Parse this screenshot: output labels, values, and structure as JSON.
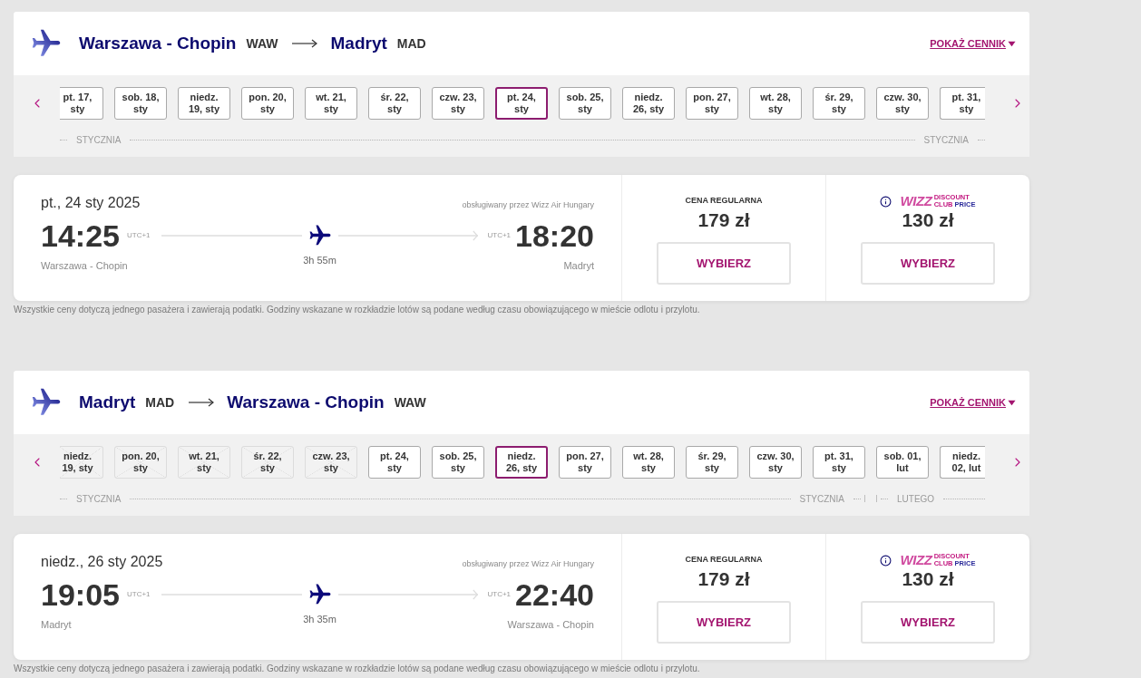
{
  "sections": [
    {
      "route": {
        "origin_name": "Warszawa - Chopin",
        "origin_code": "WAW",
        "destination_name": "Madryt",
        "destination_code": "MAD",
        "pricing_link": "POKAŻ CENNIK"
      },
      "months": [
        {
          "labels": [
            "STYCZNIA",
            "STYCZNIA"
          ],
          "dates": [
            {
              "label": "pt. 17,\nsty",
              "selected": false,
              "disabled": false
            },
            {
              "label": "sob. 18,\nsty",
              "selected": false,
              "disabled": false
            },
            {
              "label": "niedz.\n19, sty",
              "selected": false,
              "disabled": false
            },
            {
              "label": "pon. 20,\nsty",
              "selected": false,
              "disabled": false
            },
            {
              "label": "wt. 21,\nsty",
              "selected": false,
              "disabled": false
            },
            {
              "label": "śr. 22,\nsty",
              "selected": false,
              "disabled": false
            },
            {
              "label": "czw. 23,\nsty",
              "selected": false,
              "disabled": false
            },
            {
              "label": "pt. 24,\nsty",
              "selected": true,
              "disabled": false
            },
            {
              "label": "sob. 25,\nsty",
              "selected": false,
              "disabled": false
            },
            {
              "label": "niedz.\n26, sty",
              "selected": false,
              "disabled": false
            },
            {
              "label": "pon. 27,\nsty",
              "selected": false,
              "disabled": false
            },
            {
              "label": "wt. 28,\nsty",
              "selected": false,
              "disabled": false
            },
            {
              "label": "śr. 29,\nsty",
              "selected": false,
              "disabled": false
            },
            {
              "label": "czw. 30,\nsty",
              "selected": false,
              "disabled": false
            },
            {
              "label": "pt. 31,\nsty",
              "selected": false,
              "disabled": false
            }
          ]
        }
      ],
      "flight": {
        "date": "pt., 24 sty 2025",
        "operator": "obsługiwany przez Wizz Air Hungary",
        "departure_time": "14:25",
        "departure_zone": "UTC+1",
        "arrival_zone": "UTC+1",
        "arrival_time": "18:20",
        "departure_airport": "Warszawa - Chopin",
        "duration": "3h 55m",
        "arrival_airport": "Madryt"
      },
      "fares": [
        {
          "kind": "regular",
          "title": "CENA REGULARNA",
          "price": "179 zł",
          "button": "WYBIERZ"
        },
        {
          "kind": "club",
          "logo": {
            "wordmark": "WIZZ",
            "words": [
              "DISCOUNT",
              "CLUB",
              "PRICE"
            ]
          },
          "price": "130 zł",
          "button": "WYBIERZ"
        }
      ],
      "note": "Wszystkie ceny dotyczą jednego pasażera i zawierają podatki. Godziny wskazane w rozkładzie lotów są podane według czasu obowiązującego w mieście odlotu i przylotu."
    },
    {
      "route": {
        "origin_name": "Madryt",
        "origin_code": "MAD",
        "destination_name": "Warszawa - Chopin",
        "destination_code": "WAW",
        "pricing_link": "POKAŻ CENNIK"
      },
      "months": [
        {
          "labels": [
            "STYCZNIA",
            "STYCZNIA"
          ],
          "dates": [
            {
              "label": "niedz.\n19, sty",
              "selected": false,
              "disabled": true
            },
            {
              "label": "pon. 20,\nsty",
              "selected": false,
              "disabled": true
            },
            {
              "label": "wt. 21,\nsty",
              "selected": false,
              "disabled": true
            },
            {
              "label": "śr. 22,\nsty",
              "selected": false,
              "disabled": true
            },
            {
              "label": "czw. 23,\nsty",
              "selected": false,
              "disabled": true
            },
            {
              "label": "pt. 24,\nsty",
              "selected": false,
              "disabled": false
            },
            {
              "label": "sob. 25,\nsty",
              "selected": false,
              "disabled": false
            },
            {
              "label": "niedz.\n26, sty",
              "selected": true,
              "disabled": false
            },
            {
              "label": "pon. 27,\nsty",
              "selected": false,
              "disabled": false
            },
            {
              "label": "wt. 28,\nsty",
              "selected": false,
              "disabled": false
            },
            {
              "label": "śr. 29,\nsty",
              "selected": false,
              "disabled": false
            },
            {
              "label": "czw. 30,\nsty",
              "selected": false,
              "disabled": false
            },
            {
              "label": "pt. 31,\nsty",
              "selected": false,
              "disabled": false
            }
          ]
        },
        {
          "labels": [
            "LUTEGO"
          ],
          "dates": [
            {
              "label": "sob. 01,\nlut",
              "selected": false,
              "disabled": false
            },
            {
              "label": "niedz.\n02, lut",
              "selected": false,
              "disabled": false
            }
          ]
        }
      ],
      "flight": {
        "date": "niedz., 26 sty 2025",
        "operator": "obsługiwany przez Wizz Air Hungary",
        "departure_time": "19:05",
        "departure_zone": "UTC+1",
        "arrival_zone": "UTC+1",
        "arrival_time": "22:40",
        "departure_airport": "Madryt",
        "duration": "3h 35m",
        "arrival_airport": "Warszawa - Chopin"
      },
      "fares": [
        {
          "kind": "regular",
          "title": "CENA REGULARNA",
          "price": "179 zł",
          "button": "WYBIERZ"
        },
        {
          "kind": "club",
          "logo": {
            "wordmark": "WIZZ",
            "words": [
              "DISCOUNT",
              "CLUB",
              "PRICE"
            ]
          },
          "price": "130 zł",
          "button": "WYBIERZ"
        }
      ],
      "note": "Wszystkie ceny dotyczą jednego pasażera i zawierają podatki. Godziny wskazane w rozkładzie lotów są podane według czasu obowiązującego w mieście odlotu i przylotu."
    }
  ]
}
